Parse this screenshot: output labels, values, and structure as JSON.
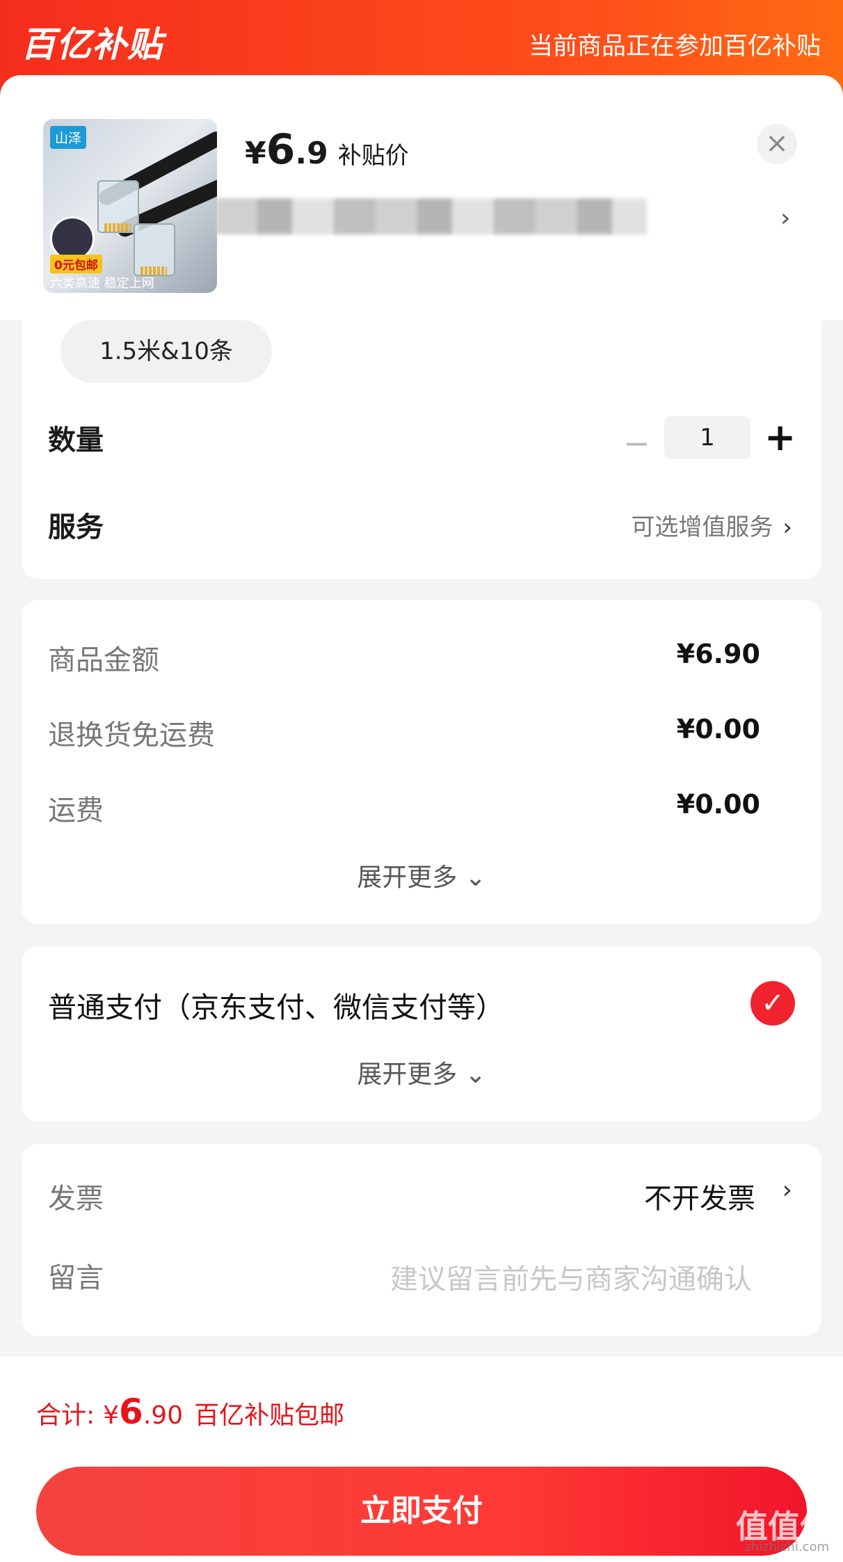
{
  "header": {
    "logo_text": "百亿补贴",
    "tip": "当前商品正在参加百亿补贴"
  },
  "product": {
    "currency": "¥",
    "price_int": "6",
    "price_dec": ".9",
    "price_label": "补贴价",
    "close_icon": "×",
    "title_arrow": "›",
    "thumb": {
      "brand": "山泽",
      "badge": "0元包邮",
      "tagline": "六类高速 稳定上网"
    },
    "spec": "1.5米&10条"
  },
  "quantity": {
    "label": "数量",
    "minus": "−",
    "value": "1",
    "plus": "+"
  },
  "service": {
    "label": "服务",
    "value": "可选增值服务",
    "chevron": "›"
  },
  "fees": {
    "rows": [
      {
        "label": "商品金额",
        "value": "¥6.90"
      },
      {
        "label": "退换货免运费",
        "value": "¥0.00"
      },
      {
        "label": "运费",
        "value": "¥0.00"
      }
    ],
    "more": "展开更多 ⌄"
  },
  "payment": {
    "label": "普通支付（京东支付、微信支付等）",
    "check": "✓",
    "more": "展开更多 ⌄"
  },
  "invoice": {
    "label": "发票",
    "value": "不开发票",
    "chevron": "›"
  },
  "message": {
    "label": "留言",
    "placeholder": "建议留言前先与商家沟通确认"
  },
  "total": {
    "label": "合计:",
    "currency": "¥",
    "int": "6",
    "dec": ".90",
    "tail": "百亿补贴包邮"
  },
  "pay_button": "立即支付",
  "watermark": {
    "main": "值值值",
    "sub": "zhizhizhi.com"
  },
  "colors": {
    "brand_red": "#f52d1d",
    "accent_orange": "#ff6a12",
    "price_red": "#e8141b"
  }
}
